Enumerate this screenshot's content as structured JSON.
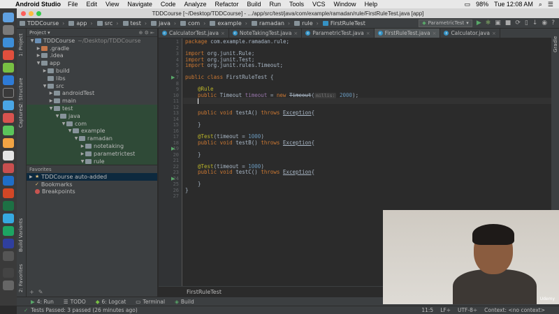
{
  "menubar": {
    "app_name": "Android Studio",
    "items": [
      "File",
      "Edit",
      "View",
      "Navigate",
      "Code",
      "Analyze",
      "Refactor",
      "Build",
      "Run",
      "Tools",
      "VCS",
      "Window",
      "Help"
    ],
    "battery": "98%",
    "clock": "Tue 12:08 AM"
  },
  "window": {
    "title": "TDDCourse [~/Desktop/TDDCourse] - .../app/src/test/java/com/example/ramadan/rule/FirstRuleTest.java [app]"
  },
  "nav": {
    "crumbs": [
      "TDDCourse",
      "app",
      "src",
      "test",
      "java",
      "com",
      "example",
      "ramadan",
      "rule",
      "FirstRuleTest"
    ],
    "run_config": "ParametricTest"
  },
  "left_strip": {
    "project": "1: Project",
    "structure": "2: Structure",
    "captures": "Captures",
    "build_variants": "Build Variants",
    "favorites": "2: Favorites"
  },
  "project_panel": {
    "header": "Project",
    "tree": [
      {
        "label": "TDDCourse",
        "extra": "~/Desktop/TDDCourse",
        "indent": 0,
        "arrow": "▼"
      },
      {
        "label": ".gradle",
        "indent": 1,
        "arrow": "▶"
      },
      {
        "label": ".idea",
        "indent": 1,
        "arrow": "▶"
      },
      {
        "label": "app",
        "indent": 1,
        "arrow": "▼"
      },
      {
        "label": "build",
        "indent": 2,
        "arrow": "▶"
      },
      {
        "label": "libs",
        "indent": 2,
        "arrow": ""
      },
      {
        "label": "src",
        "indent": 2,
        "arrow": "▼"
      },
      {
        "label": "androidTest",
        "indent": 3,
        "arrow": "▶"
      },
      {
        "label": "main",
        "indent": 3,
        "arrow": "▶"
      },
      {
        "label": "test",
        "indent": 3,
        "arrow": "▼"
      },
      {
        "label": "java",
        "indent": 4,
        "arrow": "▼"
      },
      {
        "label": "com",
        "indent": 5,
        "arrow": "▼"
      },
      {
        "label": "example",
        "indent": 6,
        "arrow": "▼"
      },
      {
        "label": "ramadan",
        "indent": 7,
        "arrow": "▼"
      },
      {
        "label": "notetaking",
        "indent": 8,
        "arrow": "▶"
      },
      {
        "label": "parametrictest",
        "indent": 8,
        "arrow": "▶"
      },
      {
        "label": "rule",
        "indent": 8,
        "arrow": "▼"
      }
    ]
  },
  "favorites": {
    "header": "Favorites",
    "items": [
      "TDDCourse auto-added",
      "Bookmarks",
      "Breakpoints"
    ]
  },
  "tabs": [
    {
      "label": "CalculatorTest.java",
      "active": false
    },
    {
      "label": "NoteTakingTest.java",
      "active": false
    },
    {
      "label": "ParametricTest.java",
      "active": false
    },
    {
      "label": "FirstRuleTest.java",
      "active": true
    },
    {
      "label": "Calculator.java",
      "active": false
    }
  ],
  "editor": {
    "line_numbers": [
      "1",
      "2",
      "3",
      "4",
      "5",
      "6",
      "7",
      "8",
      "9",
      "10",
      "11",
      "12",
      "13",
      "14",
      "15",
      "16",
      "17",
      "18",
      "19",
      "20",
      "21",
      "22",
      "23",
      "24",
      "25",
      "26",
      "27"
    ],
    "lines": {
      "l1a": "package ",
      "l1b": "com.example.ramadan.rule;",
      "l3a": "import ",
      "l3b": "org.junit.Rule;",
      "l4a": "import ",
      "l4b": "org.junit.Test;",
      "l5a": "import ",
      "l5b": "org.junit.rules.Timeout;",
      "l7a": "public class ",
      "l7b": "FirstRuleTest {",
      "l9": "@Rule",
      "l10a": "public ",
      "l10b": "Timeout ",
      "l10c": "timeout",
      "l10d": " = ",
      "l10e": "new ",
      "l10f": "Timeout",
      "l10g": "(",
      "l10h": "millis:",
      "l10i": " ",
      "l10j": "2000",
      "l10k": ");",
      "l13a": "public void ",
      "l13b": "testA",
      "l13c": "() ",
      "l13d": "throws ",
      "l13e": "Exception",
      "l13f": "{",
      "l15": "}",
      "l18a": "@Test",
      "l18b": "(timeout = ",
      "l18c": "1000",
      "l18d": ")",
      "l19a": "public void ",
      "l19b": "testB",
      "l19c": "() ",
      "l19d": "throws ",
      "l19e": "Exception",
      "l19f": "{",
      "l21": "}",
      "l23a": "@Test",
      "l23b": "(timeout = ",
      "l23c": "1000",
      "l23d": ")",
      "l24a": "public void ",
      "l24b": "testC",
      "l24c": "() ",
      "l24d": "throws ",
      "l24e": "Exception",
      "l24f": "{",
      "l26": "}",
      "l27": "}"
    },
    "breadcrumb": "FirstRuleTest"
  },
  "right_strip": {
    "gradle": "Gradle"
  },
  "bottom_tools": [
    {
      "label": "4: Run",
      "icon": "play-icon"
    },
    {
      "label": "TODO",
      "icon": "todo-icon"
    },
    {
      "label": "6: Logcat",
      "icon": "logcat-icon"
    },
    {
      "label": "Terminal",
      "icon": "terminal-icon"
    },
    {
      "label": "Build",
      "icon": "build-icon"
    }
  ],
  "status": {
    "message": "Tests Passed: 3 passed (26 minutes ago)",
    "position": "11:5",
    "line_sep": "LF÷",
    "encoding": "UTF-8÷",
    "context": "Context: <no context>"
  },
  "webcam": {
    "watermark": "Udemy"
  },
  "colors": {
    "keyword": "#cc7832",
    "annotation": "#bbb529",
    "number": "#6897bb",
    "field": "#9876aa",
    "text": "#a9b7c6"
  }
}
